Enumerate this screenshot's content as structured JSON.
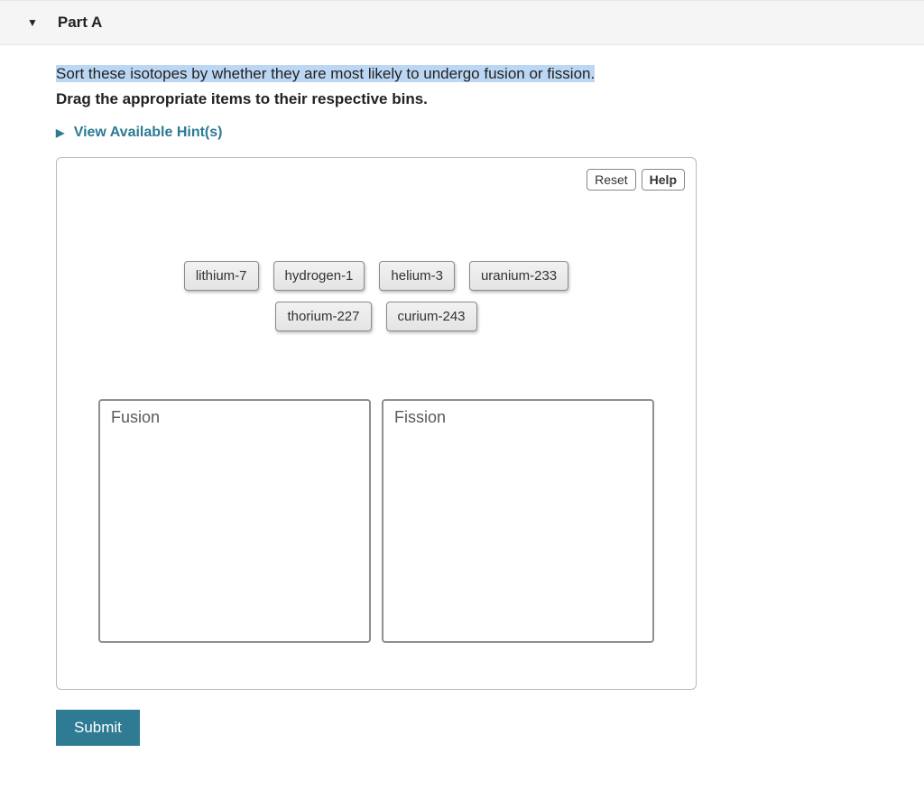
{
  "header": {
    "title": "Part A"
  },
  "question": {
    "prompt": "Sort these isotopes by whether they are most likely to undergo fusion or fission.",
    "instructions": "Drag the appropriate items to their respective bins.",
    "hints_label": "View Available Hint(s)"
  },
  "toolbar": {
    "reset_label": "Reset",
    "help_label": "Help"
  },
  "items": [
    {
      "label": "lithium-7"
    },
    {
      "label": "hydrogen-1"
    },
    {
      "label": "helium-3"
    },
    {
      "label": "uranium-233"
    },
    {
      "label": "thorium-227"
    },
    {
      "label": "curium-243"
    }
  ],
  "bins": [
    {
      "label": "Fusion"
    },
    {
      "label": "Fission"
    }
  ],
  "actions": {
    "submit_label": "Submit"
  }
}
